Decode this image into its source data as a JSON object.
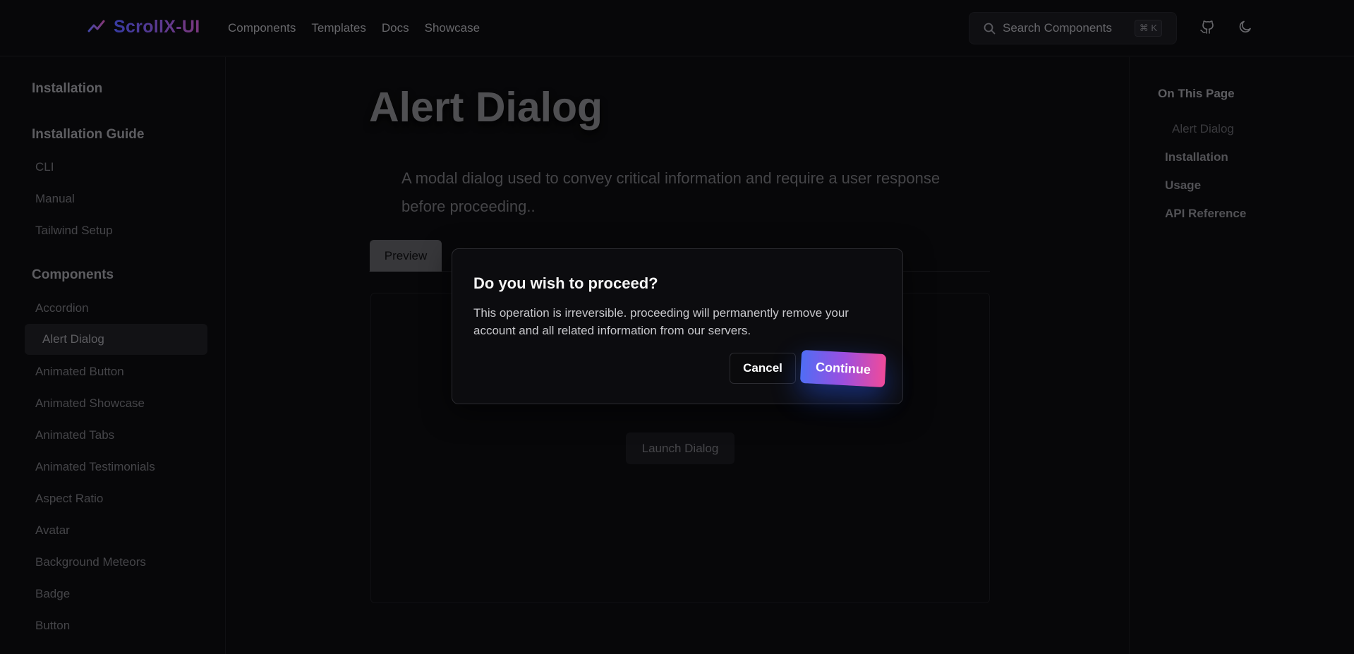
{
  "header": {
    "brand": "ScrollX-UI",
    "nav": [
      "Components",
      "Templates",
      "Docs",
      "Showcase"
    ],
    "search_placeholder": "Search Components",
    "search_shortcut": "⌘ K"
  },
  "sidebar": {
    "installation": "Installation",
    "installation_guide": "Installation Guide",
    "guide_items": [
      "CLI",
      "Manual",
      "Tailwind Setup"
    ],
    "components_heading": "Components",
    "component_items": [
      "Accordion",
      "Alert Dialog",
      "Animated Button",
      "Animated Showcase",
      "Animated Tabs",
      "Animated Testimonials",
      "Aspect Ratio",
      "Avatar",
      "Background Meteors",
      "Badge",
      "Button"
    ],
    "active_item": "Alert Dialog"
  },
  "main": {
    "title": "Alert Dialog",
    "description": "A modal dialog used to convey critical information and require a user response before proceeding..",
    "tab_preview": "Preview",
    "launch_label": "Launch Dialog"
  },
  "toc": {
    "title": "On This Page",
    "items": [
      "Alert Dialog",
      "Installation",
      "Usage",
      "API Reference"
    ]
  },
  "dialog": {
    "title": "Do you wish to proceed?",
    "text": "This operation is irreversible. proceeding will permanently remove your account and all related information from our servers.",
    "cancel": "Cancel",
    "continue": "Continue"
  },
  "colors": {
    "background": "#0a0a0c",
    "brand_gradient_start": "#4a4fd9",
    "brand_gradient_end": "#a34aa8",
    "continue_gradient": [
      "#4f6df5",
      "#9b4fe0",
      "#f04a9a"
    ]
  },
  "icons": [
    "logo-chart-icon",
    "search-icon",
    "github-icon",
    "moon-icon"
  ]
}
